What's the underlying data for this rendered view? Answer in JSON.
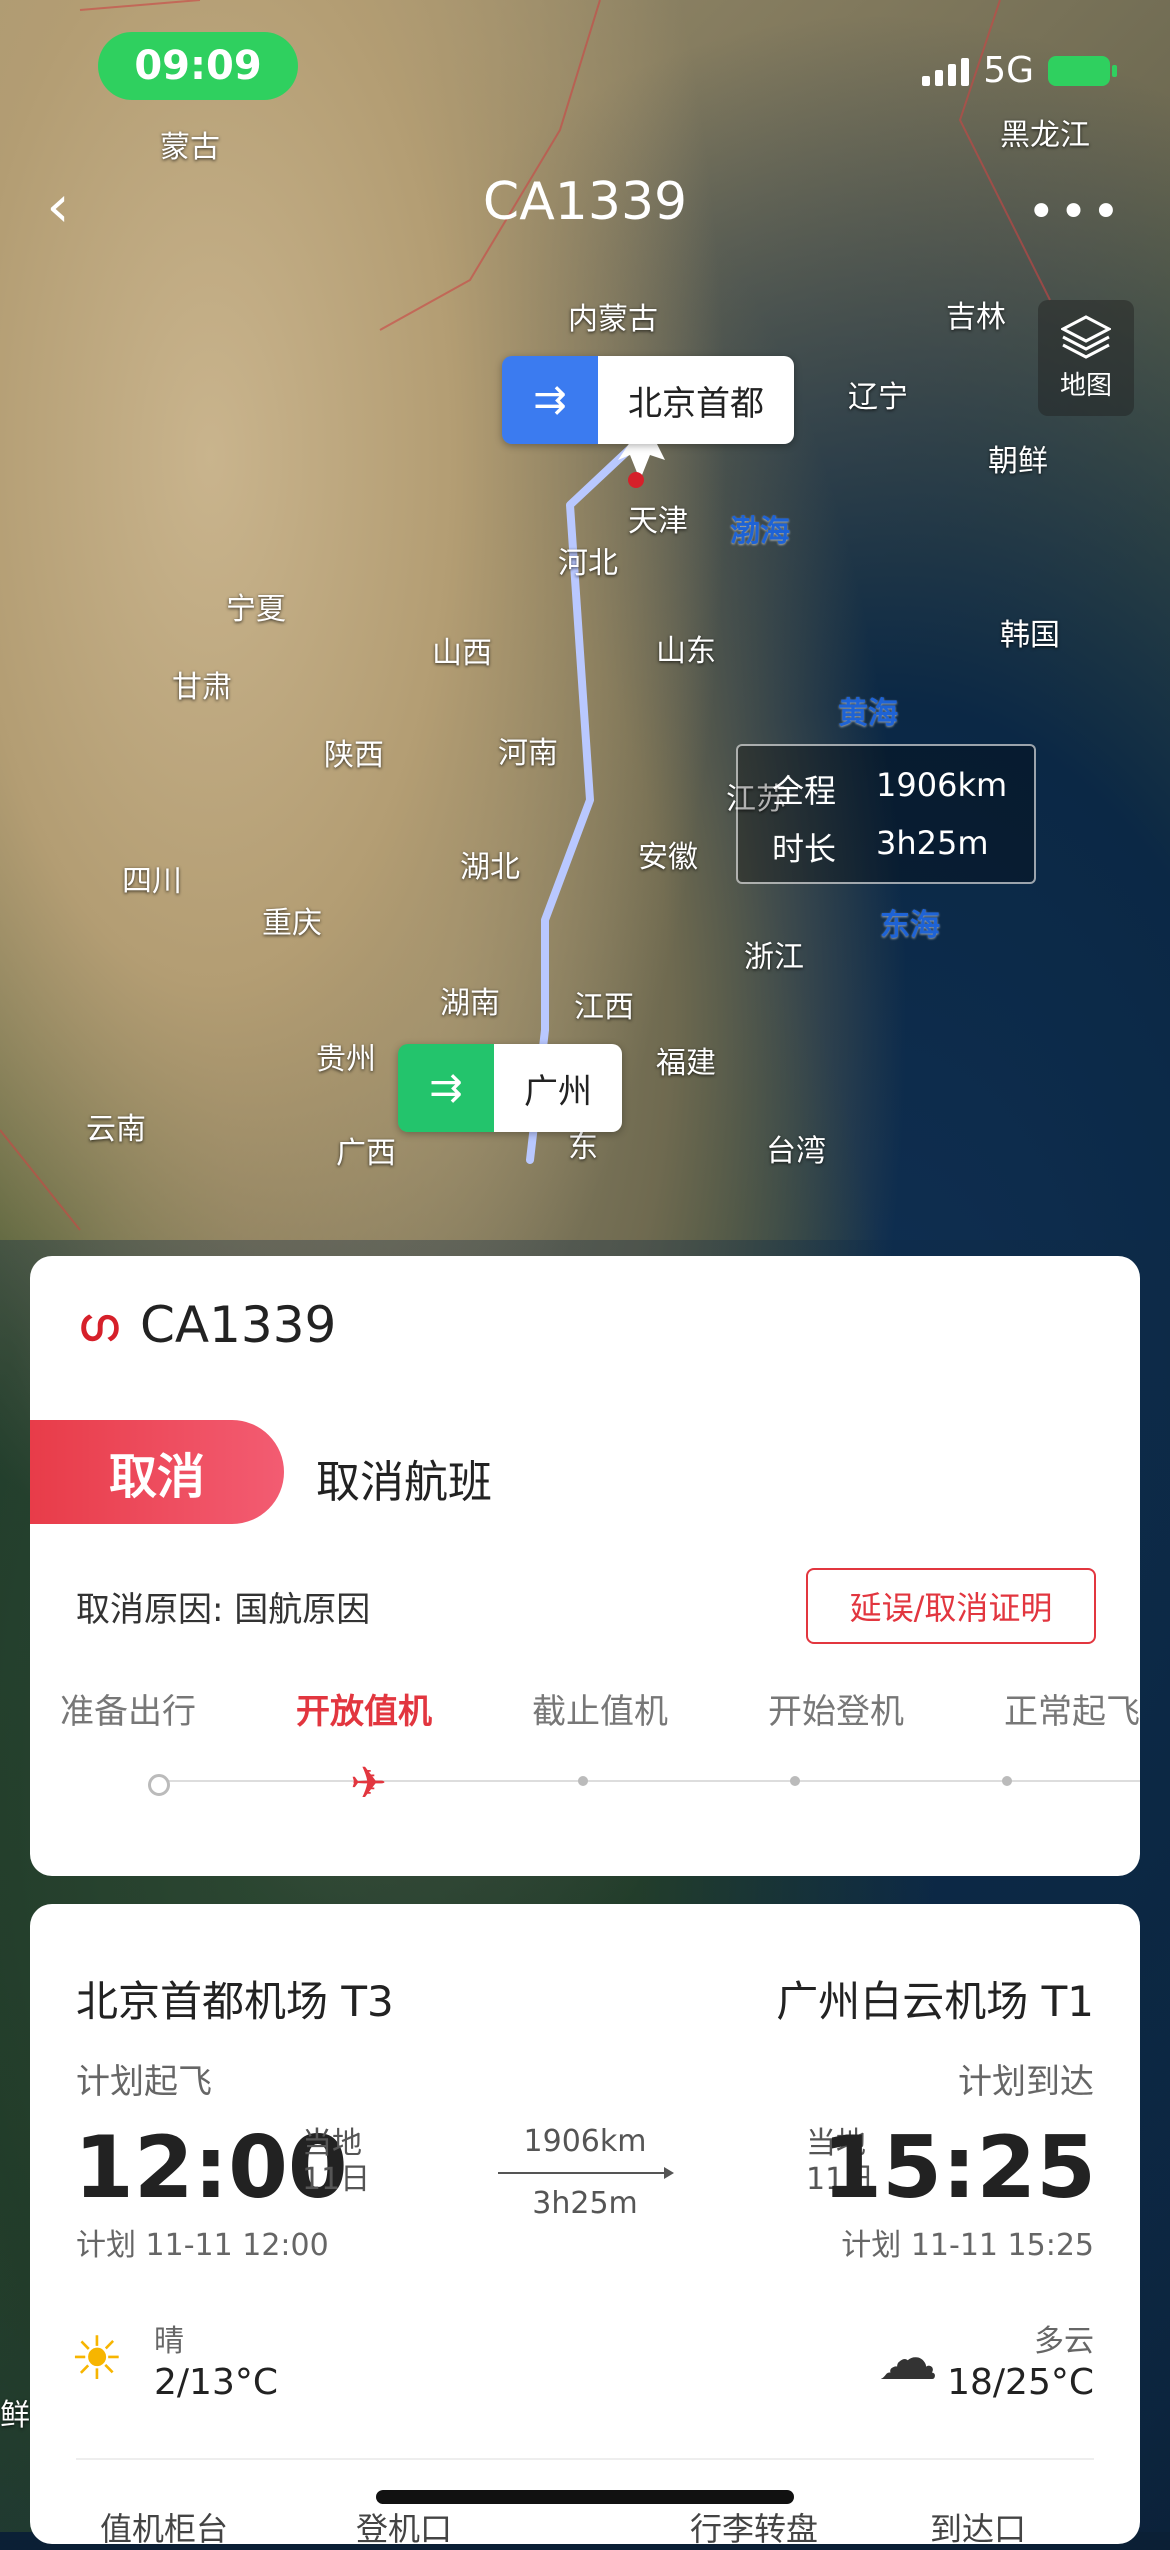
{
  "status": {
    "time": "09:09",
    "network": "5G"
  },
  "nav": {
    "back_icon": "chevron-left-icon",
    "title": "CA1339",
    "more_label": "•••"
  },
  "map": {
    "layer_button_label": "地图",
    "places": [
      "蒙古",
      "黑龙江",
      "内蒙古",
      "吉林",
      "辽宁",
      "朝鲜",
      "天津",
      "河北",
      "宁夏",
      "山西",
      "山东",
      "甘肃",
      "陕西",
      "河南",
      "韩国",
      "四川",
      "重庆",
      "湖北",
      "安徽",
      "江苏",
      "湖南",
      "江西",
      "浙江",
      "贵州",
      "福建",
      "云南",
      "广西",
      "东",
      "台湾",
      "鲜"
    ],
    "seas": [
      "渤海",
      "黄海",
      "东海"
    ],
    "origin_tag": "北京首都",
    "destination_tag": "广州",
    "distance_label": "全程",
    "distance_value": "1906km",
    "duration_label": "时长",
    "duration_value": "3h25m"
  },
  "status_card": {
    "airline_logo": "air-china-logo",
    "flight_no": "CA1339",
    "status_badge": "取消",
    "status_text": "取消航班",
    "reason": "取消原因: 国航原因",
    "proof_button": "延误/取消证明",
    "steps": [
      "准备出行",
      "开放值机",
      "截止值机",
      "开始登机",
      "正常起飞"
    ],
    "active_step": 1
  },
  "route_card": {
    "dep_airport": "北京首都机场 T3",
    "arr_airport": "广州白云机场 T1",
    "dep_label": "计划起飞",
    "arr_label": "计划到达",
    "dep_time": "12:00",
    "arr_time": "15:25",
    "local_label": "当地",
    "day_label": "11日",
    "distance": "1906km",
    "duration": "3h25m",
    "dep_detail": "计划 11-11 12:00",
    "arr_detail": "计划 11-11 15:25",
    "dep_weather": "晴",
    "dep_temp": "2/13°C",
    "arr_weather": "多云",
    "arr_temp": "18/25°C",
    "bottom_items": [
      "值机柜台",
      "登机口",
      "行李转盘",
      "到达口"
    ]
  }
}
